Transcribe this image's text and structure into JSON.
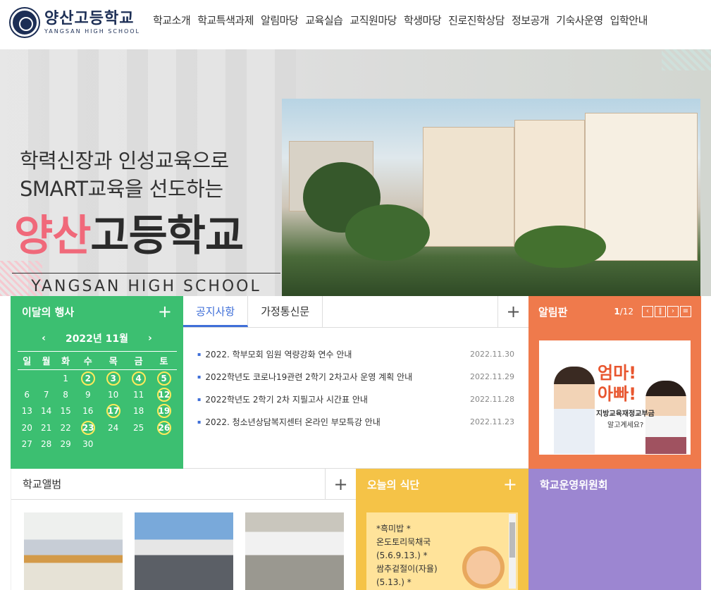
{
  "header": {
    "logo_ko": "양산고등학교",
    "logo_en": "YANGSAN HIGH SCHOOL",
    "nav": [
      "학교소개",
      "학교특색과제",
      "알림마당",
      "교육실습",
      "교직원마당",
      "학생마당",
      "진로진학상담",
      "정보공개",
      "기숙사운영",
      "입학안내"
    ]
  },
  "hero": {
    "line1": "학력신장과 인성교육으로",
    "line2": "SMART교육을 선도하는",
    "title_highlight": "양산",
    "title_rest": "고등학교",
    "en": "YANGSAN HIGH SCHOOL"
  },
  "calendar": {
    "title": "이달의 행사",
    "month": "2022년 11월",
    "weekdays": [
      "일",
      "월",
      "화",
      "수",
      "목",
      "금",
      "토"
    ],
    "weeks": [
      [
        "",
        "",
        "1",
        "2",
        "3",
        "4",
        "5"
      ],
      [
        "6",
        "7",
        "8",
        "9",
        "10",
        "11",
        "12"
      ],
      [
        "13",
        "14",
        "15",
        "16",
        "17",
        "18",
        "19"
      ],
      [
        "20",
        "21",
        "22",
        "23",
        "24",
        "25",
        "26"
      ],
      [
        "27",
        "28",
        "29",
        "30",
        "",
        "",
        ""
      ]
    ],
    "event_days": [
      "2",
      "3",
      "4",
      "5",
      "12",
      "17",
      "19",
      "23",
      "26"
    ]
  },
  "notice": {
    "tabs": [
      "공지사항",
      "가정통신문"
    ],
    "items": [
      {
        "title": "2022. 학부모회 임원 역량강화 연수 안내",
        "date": "2022.11.30"
      },
      {
        "title": "2022학년도 코로나19관련 2학기 2차고사 운영 계획 안내",
        "date": "2022.11.29"
      },
      {
        "title": "2022학년도 2학기 2차 지필고사 시간표 안내",
        "date": "2022.11.28"
      },
      {
        "title": "2022. 청소년상담복지센터 온라인 부모특강 안내",
        "date": "2022.11.23"
      }
    ]
  },
  "alarm": {
    "title": "알림판",
    "page_current": "1",
    "page_total": "/12",
    "poster_line1": "엄마!",
    "poster_line2": "아빠!",
    "poster_sub1": "지방교육재정교부금",
    "poster_sub2": "알고계세요?"
  },
  "album": {
    "title": "학교앨범"
  },
  "meal": {
    "title": "오늘의 식단",
    "lines": [
      "*흑미밥 *",
      "온도토리묵채국",
      "(5.6.9.13.) *",
      "쌈추겉절이(자율)",
      "(5.13.) *"
    ]
  },
  "board": {
    "title": "학교운영위원회"
  },
  "icons": {
    "plus": "+",
    "prev": "‹",
    "next": "›",
    "pause": "‖",
    "menu": "≡"
  },
  "colors": {
    "green": "#3cbf71",
    "orange": "#ef7a4c",
    "yellow": "#f5c347",
    "purple": "#9c86d1",
    "blue": "#3f6fd8"
  }
}
